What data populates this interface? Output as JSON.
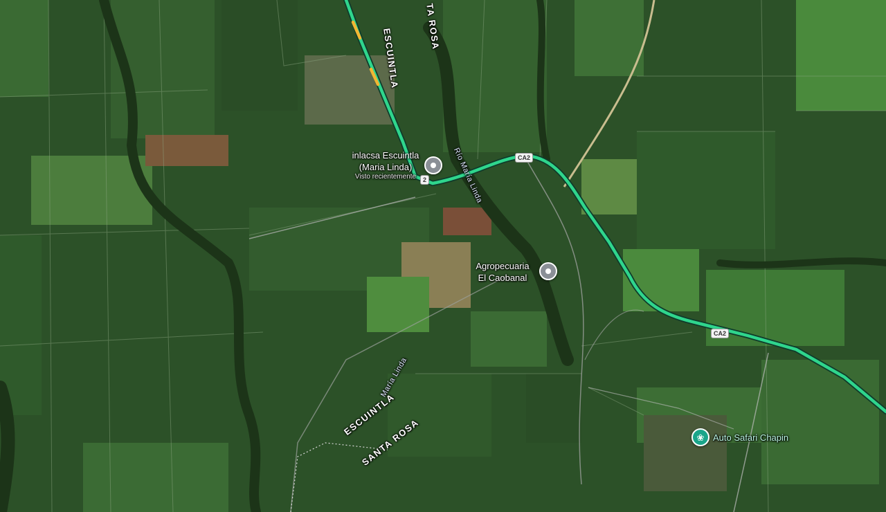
{
  "map": {
    "colors": {
      "field": "#2c5128",
      "field_alt": "#3a6a33",
      "traffic_green": "#2fd58c",
      "traffic_yellow": "#f2b733",
      "dirt_road": "#c9bd8f",
      "poi_pin": "#8a8f96",
      "poi_zoo": "#1aa58a"
    },
    "area_labels": [
      {
        "text": "ESCUINTLA"
      },
      {
        "text": "TA ROSA"
      },
      {
        "text": "ESCUINTLA"
      },
      {
        "text": "SANTA ROSA"
      }
    ],
    "river_labels": [
      {
        "text": "Río María Linda"
      },
      {
        "text": "María Linda"
      }
    ],
    "route_shields": [
      {
        "text": "CA2"
      },
      {
        "text": "CA2"
      },
      {
        "text": "2"
      }
    ],
    "pois": [
      {
        "name_line1": "inlacsa Escuintla",
        "name_line2": "(Maria Linda)",
        "sublabel": "Visto recientemente",
        "icon": "pin-icon"
      },
      {
        "name_line1": "Agropecuaria",
        "name_line2": "El Caobanal",
        "icon": "pin-icon"
      },
      {
        "name_line1": "Auto Safari Chapin",
        "icon": "paw-icon"
      }
    ]
  }
}
